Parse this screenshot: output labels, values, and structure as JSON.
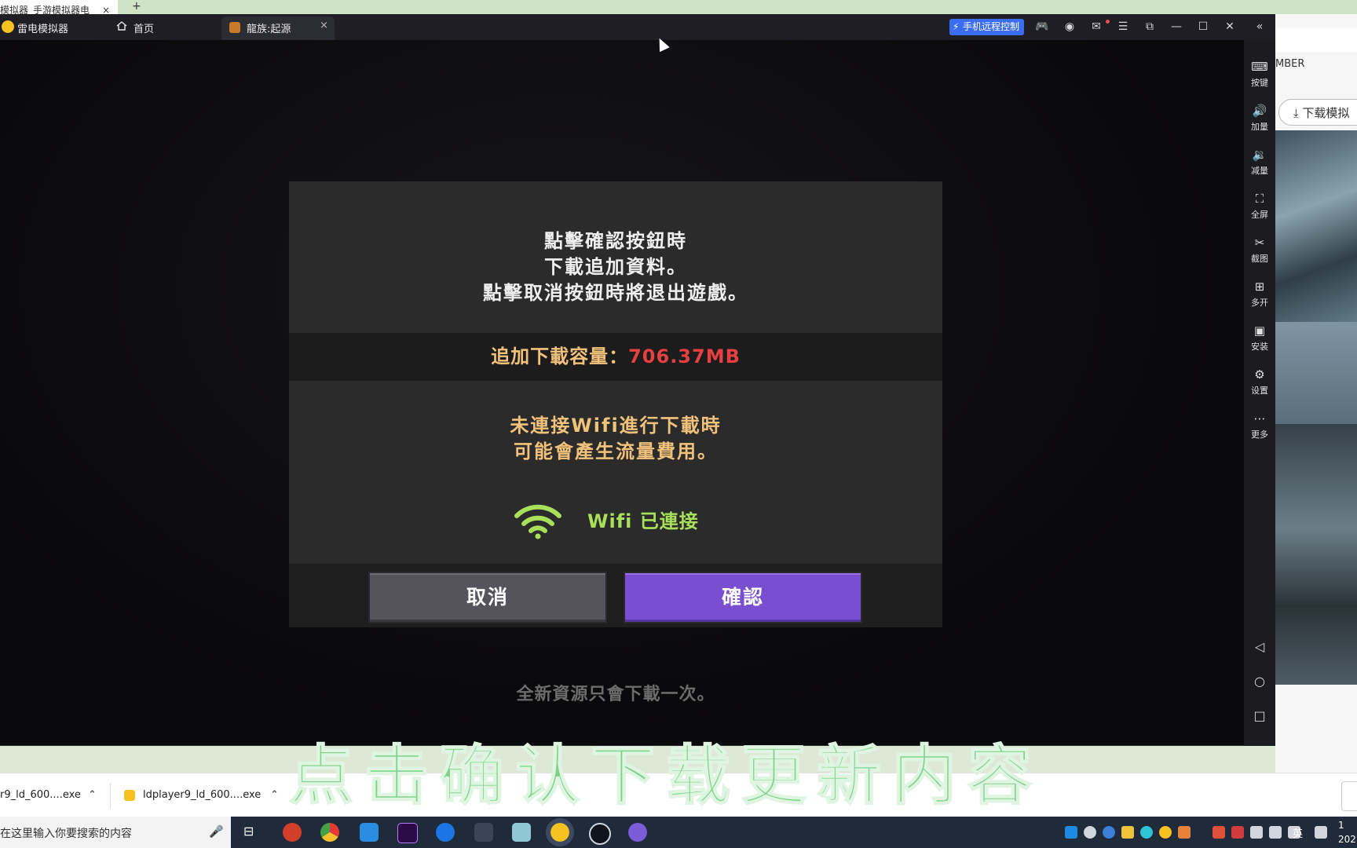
{
  "browser": {
    "tab_title": "模拟器_手游模拟器电",
    "tab_close": "×",
    "new_tab": "+",
    "panel_text": "MBER",
    "download_button": "下载模拟"
  },
  "emulator": {
    "app_name": "雷电模拟器",
    "tabs": [
      {
        "label": "首页"
      },
      {
        "label": "龍族:起源",
        "close": "×"
      }
    ],
    "remote_control": "手机远程控制",
    "sidebar": [
      {
        "icon": "keyboard-icon",
        "label": "按键"
      },
      {
        "icon": "volume-up-icon",
        "label": "加量"
      },
      {
        "icon": "volume-down-icon",
        "label": "减量"
      },
      {
        "icon": "fullscreen-icon",
        "label": "全屏"
      },
      {
        "icon": "scissors-icon",
        "label": "截图"
      },
      {
        "icon": "multi-open-icon",
        "label": "多开"
      },
      {
        "icon": "apk-icon",
        "label": "安装"
      },
      {
        "icon": "settings-icon",
        "label": "设置"
      },
      {
        "icon": "more-icon",
        "label": "更多"
      }
    ]
  },
  "dialog": {
    "message_lines": [
      "點擊確認按鈕時",
      "下載追加資料。",
      "點擊取消按鈕時將退出遊戲。"
    ],
    "size_label": "追加下載容量：",
    "size_value": "706.37MB",
    "warning_lines": [
      "未連接Wifi進行下載時",
      "可能會產生流量費用。"
    ],
    "wifi_status": "Wifi 已連接",
    "cancel": "取消",
    "confirm": "確認"
  },
  "footnote": "全新資源只會下載一次。",
  "caption": "点击确认下载更新内容",
  "downloads": [
    {
      "name": "r9_ld_600....exe"
    },
    {
      "name": "ldplayer9_ld_600....exe"
    }
  ],
  "taskbar": {
    "search_placeholder": "在这里输入你要搜索的内容",
    "ime": "英",
    "clock_time": "1",
    "clock_date": "202"
  },
  "colors": {
    "confirm": "#7a4ed0",
    "size_value": "#e84040",
    "wifi": "#a8e05a",
    "caption": "#7ed38a"
  }
}
